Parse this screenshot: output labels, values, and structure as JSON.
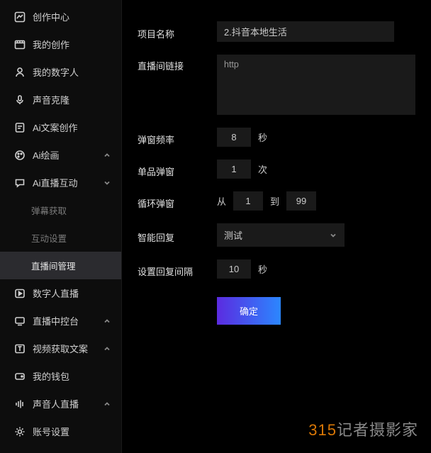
{
  "sidebar": {
    "items": [
      {
        "label": "创作中心",
        "icon": "chart-icon"
      },
      {
        "label": "我的创作",
        "icon": "film-icon"
      },
      {
        "label": "我的数字人",
        "icon": "person-icon"
      },
      {
        "label": "声音克隆",
        "icon": "mic-icon"
      },
      {
        "label": "Ai文案创作",
        "icon": "doc-ai-icon"
      },
      {
        "label": "Ai绘画",
        "icon": "palette-icon",
        "chevron": "up"
      },
      {
        "label": "Ai直播互动",
        "icon": "chat-icon",
        "chevron": "down"
      },
      {
        "label": "弹幕获取",
        "sub": true
      },
      {
        "label": "互动设置",
        "sub": true
      },
      {
        "label": "直播间管理",
        "sub": true,
        "active": true
      },
      {
        "label": "数字人直播",
        "icon": "play-icon"
      },
      {
        "label": "直播中控台",
        "icon": "console-icon",
        "chevron": "up"
      },
      {
        "label": "视频获取文案",
        "icon": "text-box-icon",
        "chevron": "up"
      },
      {
        "label": "我的钱包",
        "icon": "wallet-icon"
      },
      {
        "label": "声音人直播",
        "icon": "sound-bars-icon",
        "chevron": "up"
      },
      {
        "label": "账号设置",
        "icon": "gear-icon"
      }
    ]
  },
  "form": {
    "project_name_label": "项目名称",
    "project_name_value": "2.抖音本地生活",
    "live_link_label": "直播间链接",
    "live_link_value": "http",
    "popup_rate_label": "弹窗频率",
    "popup_rate_value": "8",
    "popup_rate_unit": "秒",
    "single_popup_label": "单品弹窗",
    "single_popup_value": "1",
    "single_popup_unit": "次",
    "loop_popup_label": "循环弹窗",
    "loop_from_label": "从",
    "loop_from_value": "1",
    "loop_to_label": "到",
    "loop_to_value": "99",
    "smart_reply_label": "智能回复",
    "smart_reply_value": "测试",
    "reply_interval_label": "设置回复间隔",
    "reply_interval_value": "10",
    "reply_interval_unit": "秒",
    "submit_label": "确定"
  },
  "watermark": {
    "num": "315",
    "text": "记者摄影家"
  }
}
